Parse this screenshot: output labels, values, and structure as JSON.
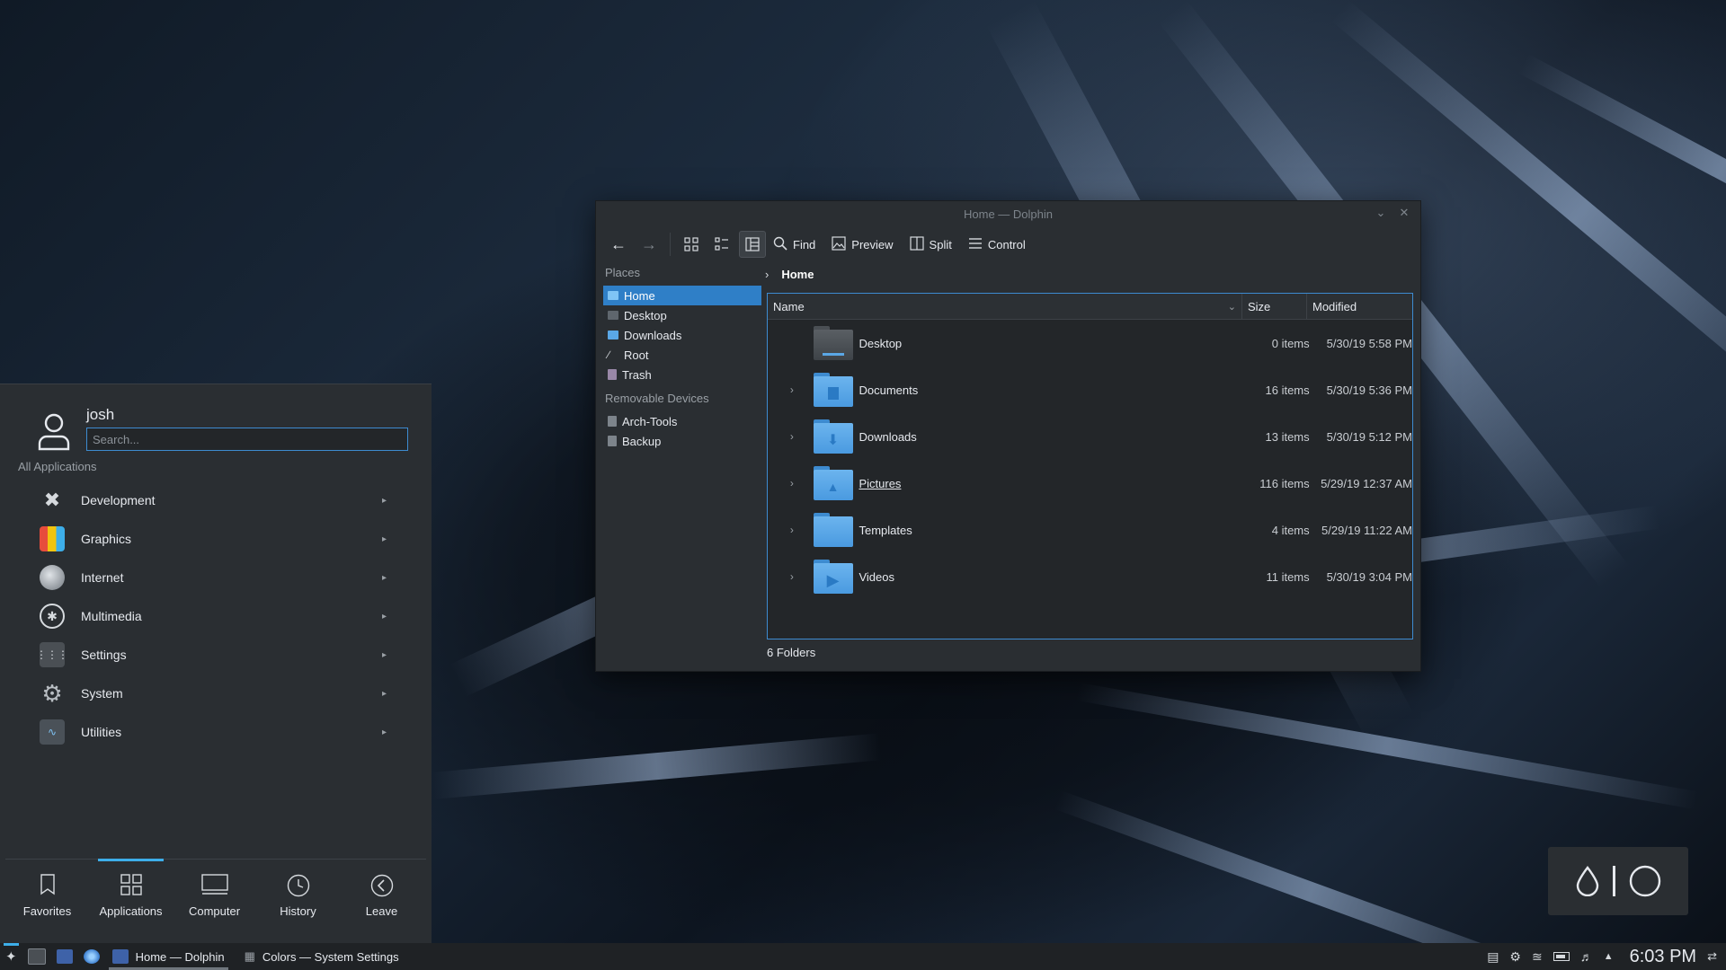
{
  "window": {
    "title": "Home — Dolphin",
    "controls": [
      "minimize-icon",
      "close-icon"
    ],
    "toolbar": {
      "find": "Find",
      "preview": "Preview",
      "split": "Split",
      "control": "Control"
    },
    "places": {
      "header": "Places",
      "items": [
        {
          "label": "Home",
          "icon": "home-icon",
          "selected": true
        },
        {
          "label": "Desktop",
          "icon": "desktop-icon"
        },
        {
          "label": "Downloads",
          "icon": "downloads-icon"
        },
        {
          "label": "Root",
          "icon": "root-icon"
        },
        {
          "label": "Trash",
          "icon": "trash-icon"
        }
      ],
      "removable_header": "Removable Devices",
      "removable": [
        {
          "label": "Arch-Tools",
          "icon": "drive-icon"
        },
        {
          "label": "Backup",
          "icon": "drive-icon"
        }
      ]
    },
    "breadcrumb": {
      "current": "Home"
    },
    "columns": {
      "name": "Name",
      "size": "Size",
      "modified": "Modified"
    },
    "files": [
      {
        "name": "Desktop",
        "size": "0 items",
        "modified": "5/30/19 5:58 PM",
        "icon": "desktop-folder-icon"
      },
      {
        "name": "Documents",
        "size": "16 items",
        "modified": "5/30/19 5:36 PM",
        "icon": "documents-folder-icon"
      },
      {
        "name": "Downloads",
        "size": "13 items",
        "modified": "5/30/19 5:12 PM",
        "icon": "downloads-folder-icon"
      },
      {
        "name": "Pictures",
        "size": "116 items",
        "modified": "5/29/19 12:37 AM",
        "icon": "pictures-folder-icon"
      },
      {
        "name": "Templates",
        "size": "4 items",
        "modified": "5/29/19 11:22 AM",
        "icon": "templates-folder-icon"
      },
      {
        "name": "Videos",
        "size": "11 items",
        "modified": "5/30/19 3:04 PM",
        "icon": "videos-folder-icon"
      }
    ],
    "status": "6 Folders"
  },
  "launcher": {
    "user": "josh",
    "search_placeholder": "Search...",
    "section": "All Applications",
    "categories": [
      {
        "label": "Development",
        "icon": "development-icon"
      },
      {
        "label": "Graphics",
        "icon": "graphics-icon"
      },
      {
        "label": "Internet",
        "icon": "internet-icon"
      },
      {
        "label": "Multimedia",
        "icon": "multimedia-icon"
      },
      {
        "label": "Settings",
        "icon": "settings-icon"
      },
      {
        "label": "System",
        "icon": "system-icon"
      },
      {
        "label": "Utilities",
        "icon": "utilities-icon"
      }
    ],
    "tabs": [
      {
        "label": "Favorites",
        "icon": "bookmark-icon"
      },
      {
        "label": "Applications",
        "icon": "grid-icon",
        "active": true
      },
      {
        "label": "Computer",
        "icon": "monitor-icon"
      },
      {
        "label": "History",
        "icon": "clock-icon"
      },
      {
        "label": "Leave",
        "icon": "back-arrow-icon"
      }
    ]
  },
  "taskbar": {
    "tasks": [
      {
        "label": "Home — Dolphin",
        "active": true
      },
      {
        "label": "Colors  — System Settings"
      }
    ],
    "clock": "6:03 PM"
  },
  "colors": {
    "accent": "#3daee9",
    "selection": "#2f7fc7",
    "folder": "#5aa7e6",
    "window_bg": "#2a2e32"
  }
}
